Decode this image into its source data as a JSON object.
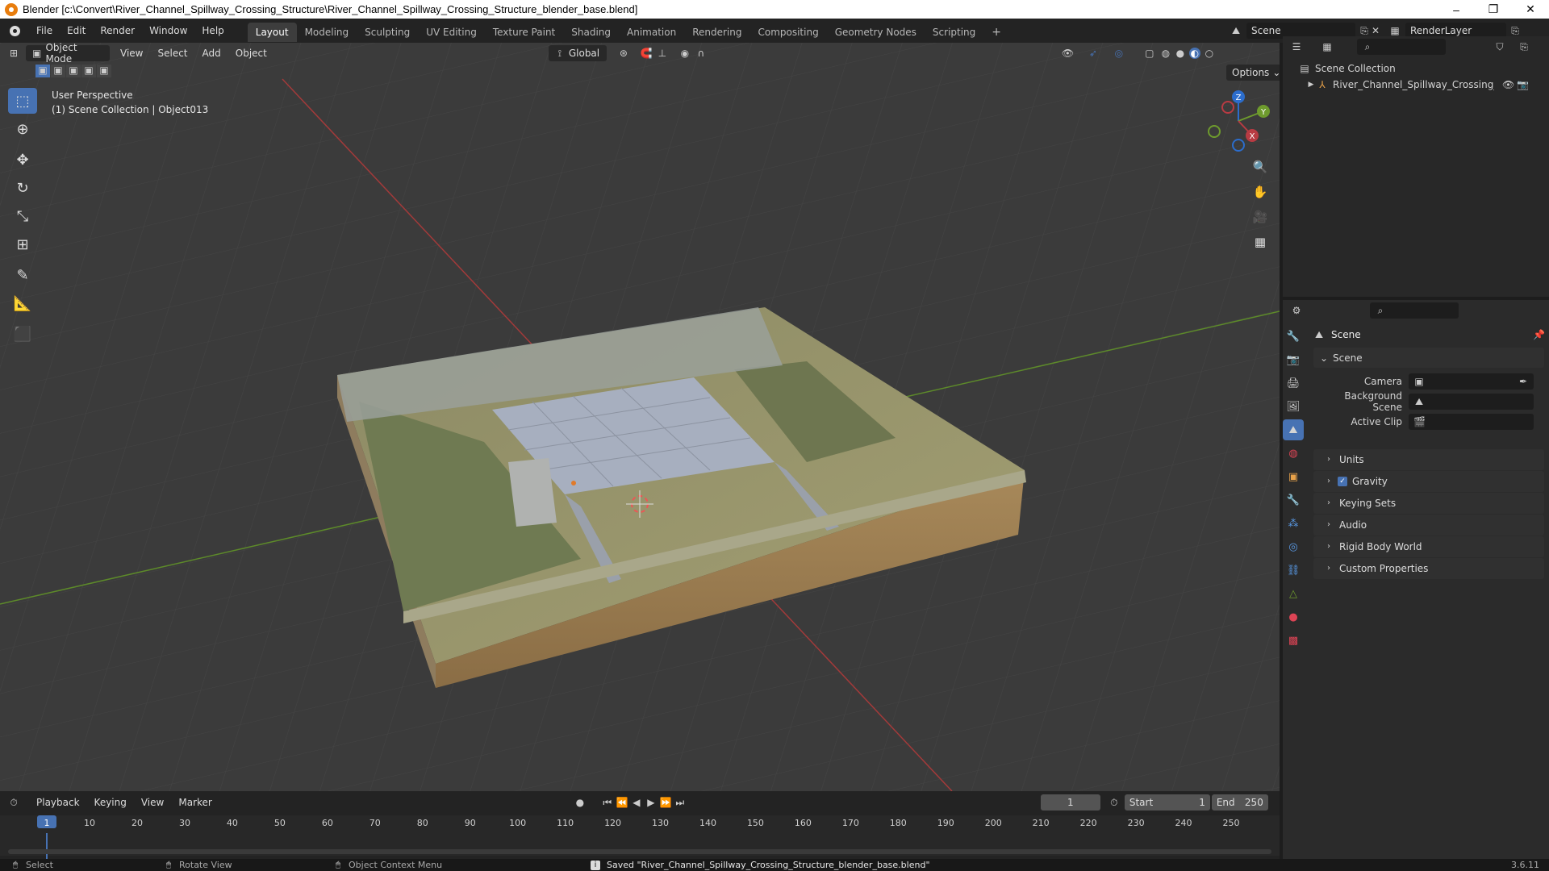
{
  "window": {
    "title": "Blender [c:\\Convert\\River_Channel_Spillway_Crossing_Structure\\River_Channel_Spillway_Crossing_Structure_blender_base.blend]",
    "controls": [
      "–",
      "❐",
      "✕"
    ]
  },
  "menus": [
    "File",
    "Edit",
    "Render",
    "Window",
    "Help"
  ],
  "workspaces": [
    "Layout",
    "Modeling",
    "Sculpting",
    "UV Editing",
    "Texture Paint",
    "Shading",
    "Animation",
    "Rendering",
    "Compositing",
    "Geometry Nodes",
    "Scripting"
  ],
  "active_workspace": "Layout",
  "scene_selector": "Scene",
  "view_layer_selector": "RenderLayer",
  "viewport": {
    "mode": "Object Mode",
    "menus": [
      "View",
      "Select",
      "Add",
      "Object"
    ],
    "orientation": "Global",
    "options_label": "Options",
    "view_name": "User Perspective",
    "collection_info": "(1) Scene Collection | Object013",
    "gizmo_axes": {
      "x": "X",
      "y": "Y",
      "z": "Z"
    },
    "colors": {
      "x_axis": "#b83b43",
      "y_axis": "#6e9b2d",
      "z_axis": "#2c6dcc",
      "active": "#4772b3"
    }
  },
  "tools": [
    "select-box",
    "cursor",
    "move",
    "rotate",
    "scale",
    "transform",
    "annotate",
    "measure",
    "add-cube"
  ],
  "outliner": {
    "root": "Scene Collection",
    "items": [
      {
        "label": "River_Channel_Spillway_Crossing_Struc"
      }
    ]
  },
  "properties": {
    "header": "Scene",
    "section": "Scene",
    "fields": [
      {
        "label": "Camera",
        "value": ""
      },
      {
        "label": "Background Scene",
        "value": ""
      },
      {
        "label": "Active Clip",
        "value": ""
      }
    ],
    "panels": [
      {
        "label": "Units",
        "checkbox": false
      },
      {
        "label": "Gravity",
        "checkbox": true
      },
      {
        "label": "Keying Sets",
        "checkbox": false
      },
      {
        "label": "Audio",
        "checkbox": false
      },
      {
        "label": "Rigid Body World",
        "checkbox": false
      },
      {
        "label": "Custom Properties",
        "checkbox": false
      }
    ]
  },
  "timeline": {
    "menus": [
      "Playback",
      "Keying",
      "View",
      "Marker"
    ],
    "current_frame": "1",
    "start_label": "Start",
    "start": "1",
    "end_label": "End",
    "end": "250",
    "ticks": [
      "1",
      "10",
      "20",
      "30",
      "40",
      "50",
      "60",
      "70",
      "80",
      "90",
      "100",
      "110",
      "120",
      "130",
      "140",
      "150",
      "160",
      "170",
      "180",
      "190",
      "200",
      "210",
      "220",
      "230",
      "240",
      "250"
    ]
  },
  "status": {
    "select": "Select",
    "rotate": "Rotate View",
    "context": "Object Context Menu",
    "message": "Saved \"River_Channel_Spillway_Crossing_Structure_blender_base.blend\"",
    "version": "3.6.11"
  }
}
